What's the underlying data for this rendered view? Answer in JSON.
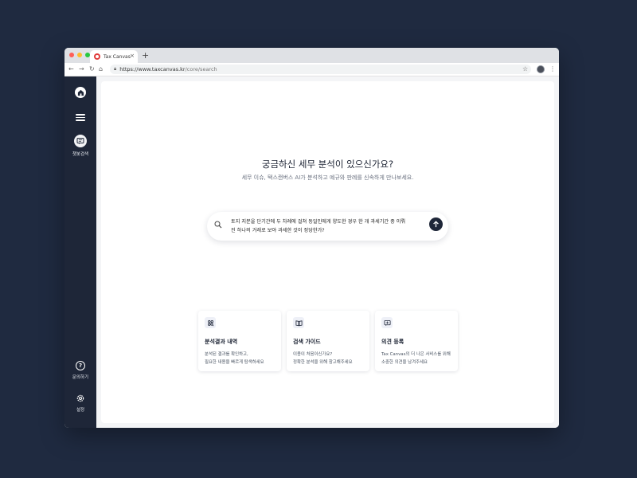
{
  "browser": {
    "tab_title": "Tax Canvas",
    "tab_close": "×",
    "new_tab": "+",
    "url_host": "https://www.taxcanvas.kr",
    "url_path": "/core/search",
    "traffic_lights": [
      "#ff5f57",
      "#febc2e",
      "#28c840"
    ]
  },
  "sidebar": {
    "search_label": "챗봇검색",
    "help_label": "문의하기",
    "settings_label": "설정"
  },
  "main": {
    "title": "궁금하신 세무 분석이 있으신가요?",
    "subtitle": "세무 이슈, 택스캔버스 AI가 분석하고 예규와 판례를 신속하게 만나보세요.",
    "query_line1": "토지 지분을 단기간에 두 차례에 걸쳐 동일인에게 양도한 경우 한 개 과세기간 중 이뤄",
    "query_line2": "진 하나의 거래로 보아 과세한 것이 정당한가?"
  },
  "cards": [
    {
      "title": "분석결과 내역",
      "desc1": "분석된 결과를 확인하고,",
      "desc2": "필요한 내용을 빠르게 탐색하세요"
    },
    {
      "title": "검색 가이드",
      "desc1": "이용이 처음이신가요?",
      "desc2": "정확한 분석을 위해 참고해주세요"
    },
    {
      "title": "의견 등록",
      "desc1": "Tax Canvas의 더 나은 서비스를 위해",
      "desc2": "소중한 의견을 남겨주세요"
    }
  ],
  "colors": {
    "background": "#1f2a40",
    "sidebar": "#1e2638",
    "accent": "#1e2638"
  }
}
